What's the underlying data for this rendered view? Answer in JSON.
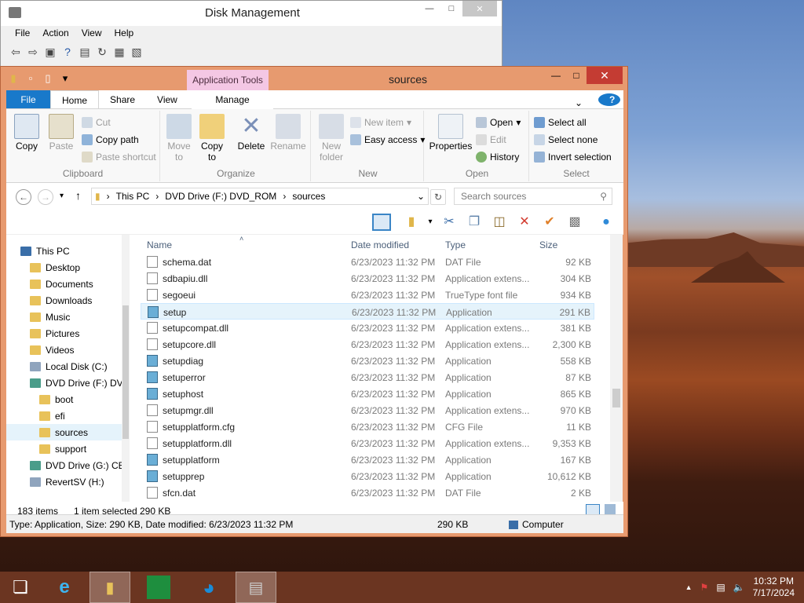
{
  "disk_mgmt": {
    "title": "Disk Management",
    "menu": [
      "File",
      "Action",
      "View",
      "Help"
    ]
  },
  "explorer": {
    "app_tools": "Application Tools",
    "title": "sources",
    "tabs": {
      "file": "File",
      "home": "Home",
      "share": "Share",
      "view": "View",
      "manage": "Manage"
    },
    "ribbon": {
      "clipboard": {
        "label": "Clipboard",
        "copy": "Copy",
        "paste": "Paste",
        "cut": "Cut",
        "copy_path": "Copy path",
        "paste_shortcut": "Paste shortcut"
      },
      "organize": {
        "label": "Organize",
        "move_to": "Move to",
        "copy_to": "Copy to",
        "delete": "Delete",
        "rename": "Rename"
      },
      "new": {
        "label": "New",
        "new_folder": "New folder",
        "new_item": "New item",
        "easy_access": "Easy access"
      },
      "open": {
        "label": "Open",
        "properties": "Properties",
        "open": "Open",
        "edit": "Edit",
        "history": "History"
      },
      "select": {
        "label": "Select",
        "select_all": "Select all",
        "select_none": "Select none",
        "invert": "Invert selection"
      }
    },
    "address": {
      "this_pc": "This PC",
      "drive": "DVD Drive (F:) DVD_ROM",
      "folder": "sources"
    },
    "search_placeholder": "Search sources",
    "nav": [
      {
        "label": "This PC",
        "icon": "pc-icon"
      },
      {
        "label": "Desktop",
        "icon": "folder-icon"
      },
      {
        "label": "Documents",
        "icon": "folder-icon"
      },
      {
        "label": "Downloads",
        "icon": "folder-icon"
      },
      {
        "label": "Music",
        "icon": "folder-icon"
      },
      {
        "label": "Pictures",
        "icon": "folder-icon"
      },
      {
        "label": "Videos",
        "icon": "folder-icon"
      },
      {
        "label": "Local Disk (C:)",
        "icon": "drive-icon"
      },
      {
        "label": "DVD Drive (F:) DV",
        "icon": "dvd-icon"
      },
      {
        "label": "boot",
        "icon": "folder-icon"
      },
      {
        "label": "efi",
        "icon": "folder-icon"
      },
      {
        "label": "sources",
        "icon": "folder-icon"
      },
      {
        "label": "support",
        "icon": "folder-icon"
      },
      {
        "label": "DVD Drive (G:) CE",
        "icon": "dvd-icon"
      },
      {
        "label": "RevertSV (H:)",
        "icon": "drive-icon"
      }
    ],
    "columns": {
      "name": "Name",
      "date": "Date modified",
      "type": "Type",
      "size": "Size"
    },
    "files": [
      {
        "name": "schema.dat",
        "date": "6/23/2023 11:32 PM",
        "type": "DAT File",
        "size": "92 KB",
        "kind": "file"
      },
      {
        "name": "sdbapiu.dll",
        "date": "6/23/2023 11:32 PM",
        "type": "Application extens...",
        "size": "304 KB",
        "kind": "dll"
      },
      {
        "name": "segoeui",
        "date": "6/23/2023 11:32 PM",
        "type": "TrueType font file",
        "size": "934 KB",
        "kind": "font"
      },
      {
        "name": "setup",
        "date": "6/23/2023 11:32 PM",
        "type": "Application",
        "size": "291 KB",
        "kind": "app"
      },
      {
        "name": "setupcompat.dll",
        "date": "6/23/2023 11:32 PM",
        "type": "Application extens...",
        "size": "381 KB",
        "kind": "dll"
      },
      {
        "name": "setupcore.dll",
        "date": "6/23/2023 11:32 PM",
        "type": "Application extens...",
        "size": "2,300 KB",
        "kind": "dll"
      },
      {
        "name": "setupdiag",
        "date": "6/23/2023 11:32 PM",
        "type": "Application",
        "size": "558 KB",
        "kind": "app"
      },
      {
        "name": "setuperror",
        "date": "6/23/2023 11:32 PM",
        "type": "Application",
        "size": "87 KB",
        "kind": "app"
      },
      {
        "name": "setuphost",
        "date": "6/23/2023 11:32 PM",
        "type": "Application",
        "size": "865 KB",
        "kind": "app"
      },
      {
        "name": "setupmgr.dll",
        "date": "6/23/2023 11:32 PM",
        "type": "Application extens...",
        "size": "970 KB",
        "kind": "dll"
      },
      {
        "name": "setupplatform.cfg",
        "date": "6/23/2023 11:32 PM",
        "type": "CFG File",
        "size": "11 KB",
        "kind": "file"
      },
      {
        "name": "setupplatform.dll",
        "date": "6/23/2023 11:32 PM",
        "type": "Application extens...",
        "size": "9,353 KB",
        "kind": "dll"
      },
      {
        "name": "setupplatform",
        "date": "6/23/2023 11:32 PM",
        "type": "Application",
        "size": "167 KB",
        "kind": "app"
      },
      {
        "name": "setupprep",
        "date": "6/23/2023 11:32 PM",
        "type": "Application",
        "size": "10,612 KB",
        "kind": "app"
      },
      {
        "name": "sfcn.dat",
        "date": "6/23/2023 11:32 PM",
        "type": "DAT File",
        "size": "2 KB",
        "kind": "file"
      }
    ],
    "status": {
      "items": "183 items",
      "selected": "1 item selected",
      "selected_size": "290 KB",
      "details": "Type: Application, Size: 290 KB, Date modified: 6/23/2023 11:32 PM",
      "size2": "290 KB",
      "computer": "Computer"
    }
  },
  "taskbar": {
    "time": "10:32 PM",
    "date": "7/17/2024"
  }
}
